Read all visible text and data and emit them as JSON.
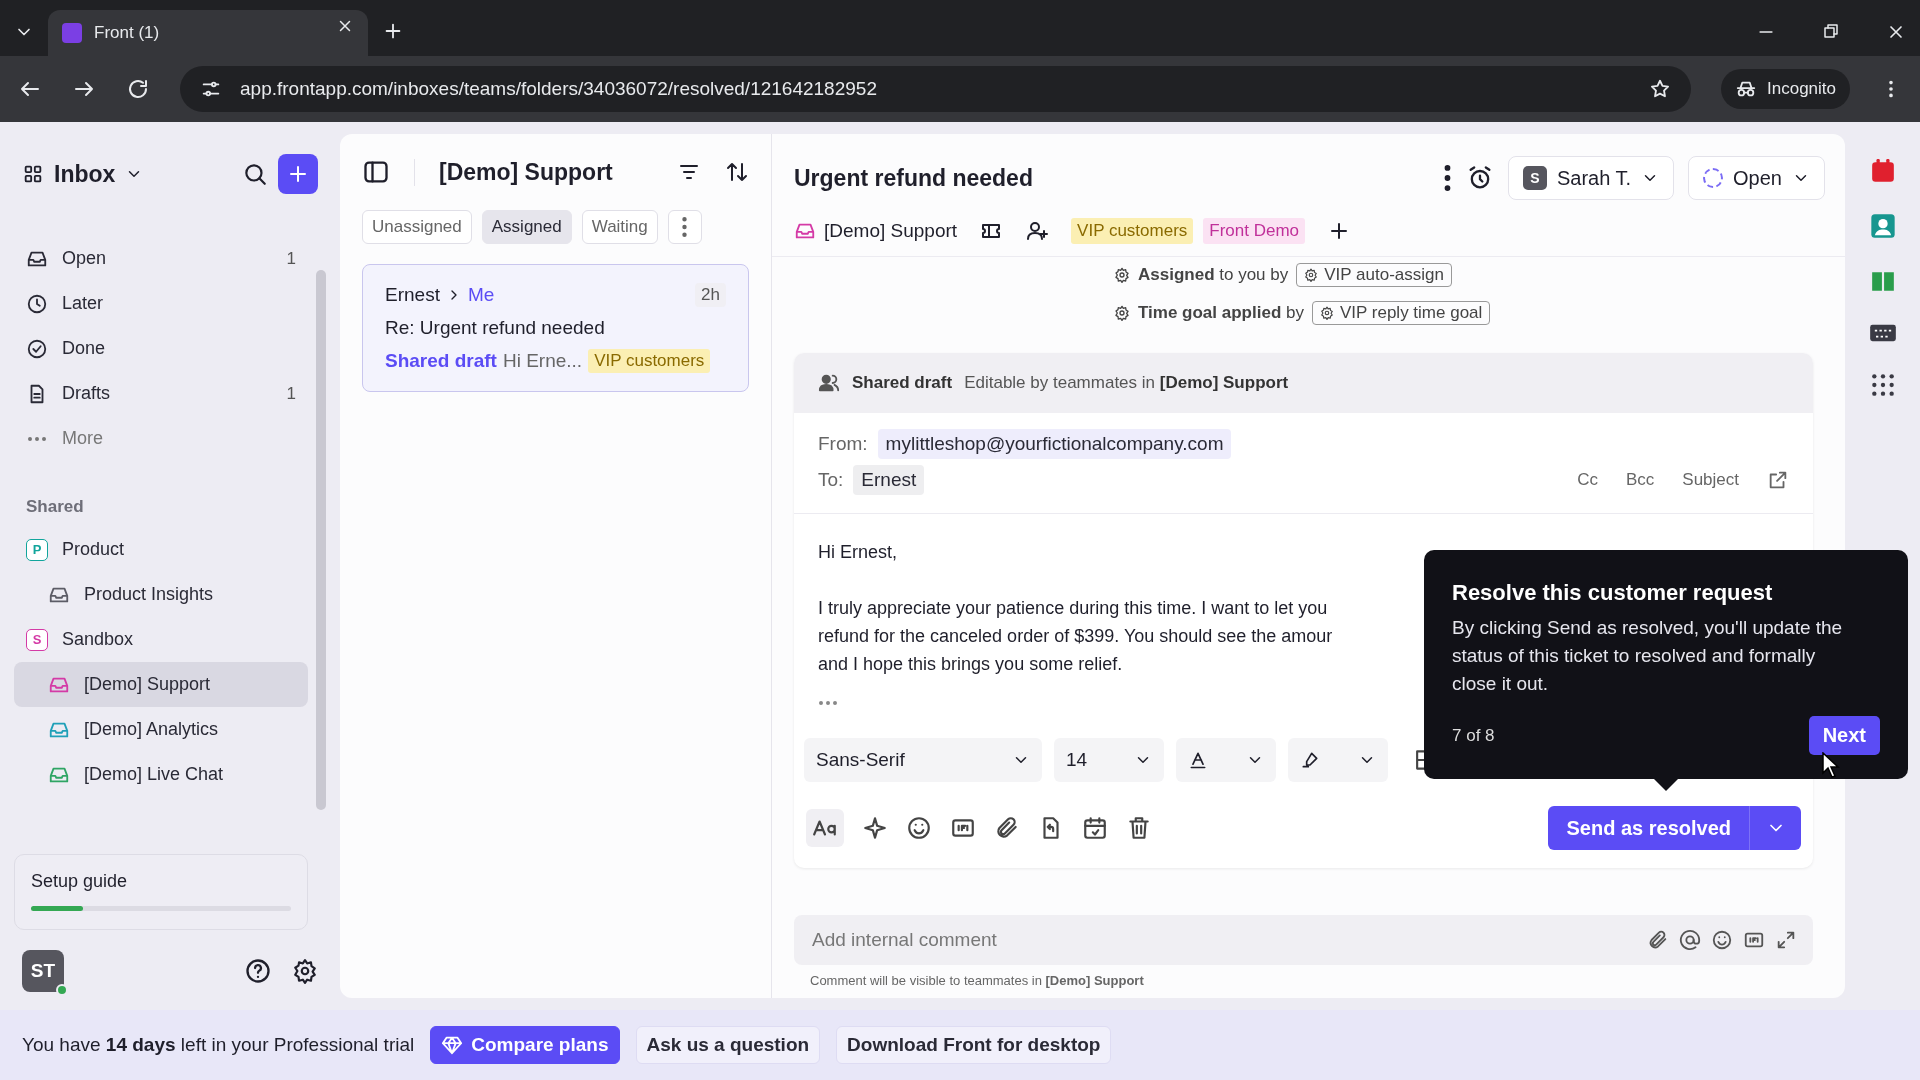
{
  "browser": {
    "tab_title": "Front (1)",
    "url": "app.frontapp.com/inboxes/teams/folders/34036072/resolved/121642182952",
    "incognito_label": "Incognito"
  },
  "sidebar": {
    "title": "Inbox",
    "items": [
      {
        "label": "Open",
        "count": "1",
        "selected": false
      },
      {
        "label": "Later",
        "selected": false
      },
      {
        "label": "Done",
        "selected": false
      },
      {
        "label": "Drafts",
        "count": "1",
        "selected": false
      }
    ],
    "more_label": "More",
    "section_label": "Shared",
    "teams": [
      {
        "letter": "P",
        "label": "Product",
        "color": "#12a59c",
        "children": [
          {
            "label": "Product Insights",
            "color": "#5c5c66",
            "selected": false
          }
        ]
      },
      {
        "letter": "S",
        "label": "Sandbox",
        "color": "#d43aa6",
        "children": [
          {
            "label": "[Demo] Support",
            "color": "#d43aa6",
            "selected": true
          },
          {
            "label": "[Demo] Analytics",
            "color": "#1fa0b8",
            "selected": false
          },
          {
            "label": "[Demo] Live Chat",
            "color": "#2fa564",
            "selected": false
          }
        ]
      }
    ],
    "setup_guide": {
      "label": "Setup guide",
      "level": 0.2
    },
    "avatar": "ST"
  },
  "list": {
    "title": "[Demo] Support",
    "filters": [
      {
        "label": "Unassigned",
        "selected": false
      },
      {
        "label": "Assigned",
        "selected": true
      },
      {
        "label": "Waiting",
        "selected": false
      }
    ],
    "conversations": [
      {
        "from": "Ernest",
        "to": "Me",
        "time": "2h",
        "subject": "Re: Urgent refund needed",
        "draft_label": "Shared draft",
        "preview": "Hi Erne...",
        "tag": "VIP customers",
        "selected": true
      }
    ]
  },
  "conversation": {
    "title": "Urgent refund needed",
    "assignee": {
      "initial": "S",
      "name": "Sarah T."
    },
    "status": "Open",
    "inbox": "[Demo] Support",
    "tags": [
      {
        "label": "VIP customers",
        "color": "#fbefb3"
      },
      {
        "label": "Front Demo",
        "color": "#fbe2f3"
      }
    ],
    "events": [
      {
        "text": "**Assigned** to you by",
        "rule": "VIP auto-assign"
      },
      {
        "text": "**Time goal applied** by",
        "rule": "VIP reply time goal"
      }
    ],
    "draft": {
      "label": "Shared draft",
      "note": "Editable by teammates in **[Demo] Support**",
      "from_label": "From:",
      "from": "mylittleshop@yourfictionalcompany.com",
      "to_label": "To:",
      "to": "Ernest",
      "links": [
        "Cc",
        "Bcc",
        "Subject"
      ],
      "greeting": "Hi Ernest,",
      "body_lines": [
        "I truly appreciate your patience during this time. I want to let you",
        "refund for the canceled order of $399. You should see the amour",
        "and I hope this brings you some relief."
      ],
      "font": "Sans-Serif",
      "size": "14",
      "send_label": "Send as resolved"
    },
    "comment": {
      "placeholder": "Add internal comment",
      "note": "Comment will be visible to teammates in **[Demo] Support**"
    }
  },
  "tooltip": {
    "title": "Resolve this customer request",
    "body": "By clicking Send as resolved, you'll update the status of this ticket to resolved and formally close it out.",
    "step": "7 of 8",
    "next": "Next"
  },
  "trial": {
    "message": "You have **14 days** left in your Professional trial",
    "compare": "Compare plans",
    "ask": "Ask us a question",
    "download": "Download Front for desktop"
  }
}
